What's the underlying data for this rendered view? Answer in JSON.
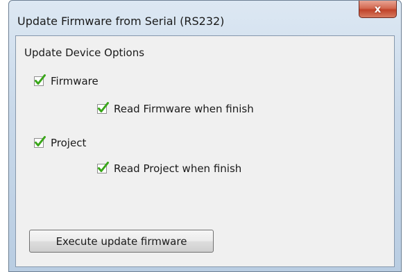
{
  "window": {
    "title": "Update Firmware from Serial (RS232)",
    "close_symbol": "x"
  },
  "group": {
    "title": "Update Device Options"
  },
  "options": {
    "firmware": {
      "label": "Firmware",
      "checked": true
    },
    "read_firmware": {
      "label": "Read Firmware when finish",
      "checked": true
    },
    "project": {
      "label": "Project",
      "checked": true
    },
    "read_project": {
      "label": "Read Project when finish",
      "checked": true
    }
  },
  "actions": {
    "execute_label": "Execute update firmware"
  },
  "colors": {
    "check_green": "#3aa61a",
    "close_red": "#c0432a"
  },
  "icons": {
    "checkbox": "checkbox-checked-icon",
    "close": "close-icon"
  }
}
